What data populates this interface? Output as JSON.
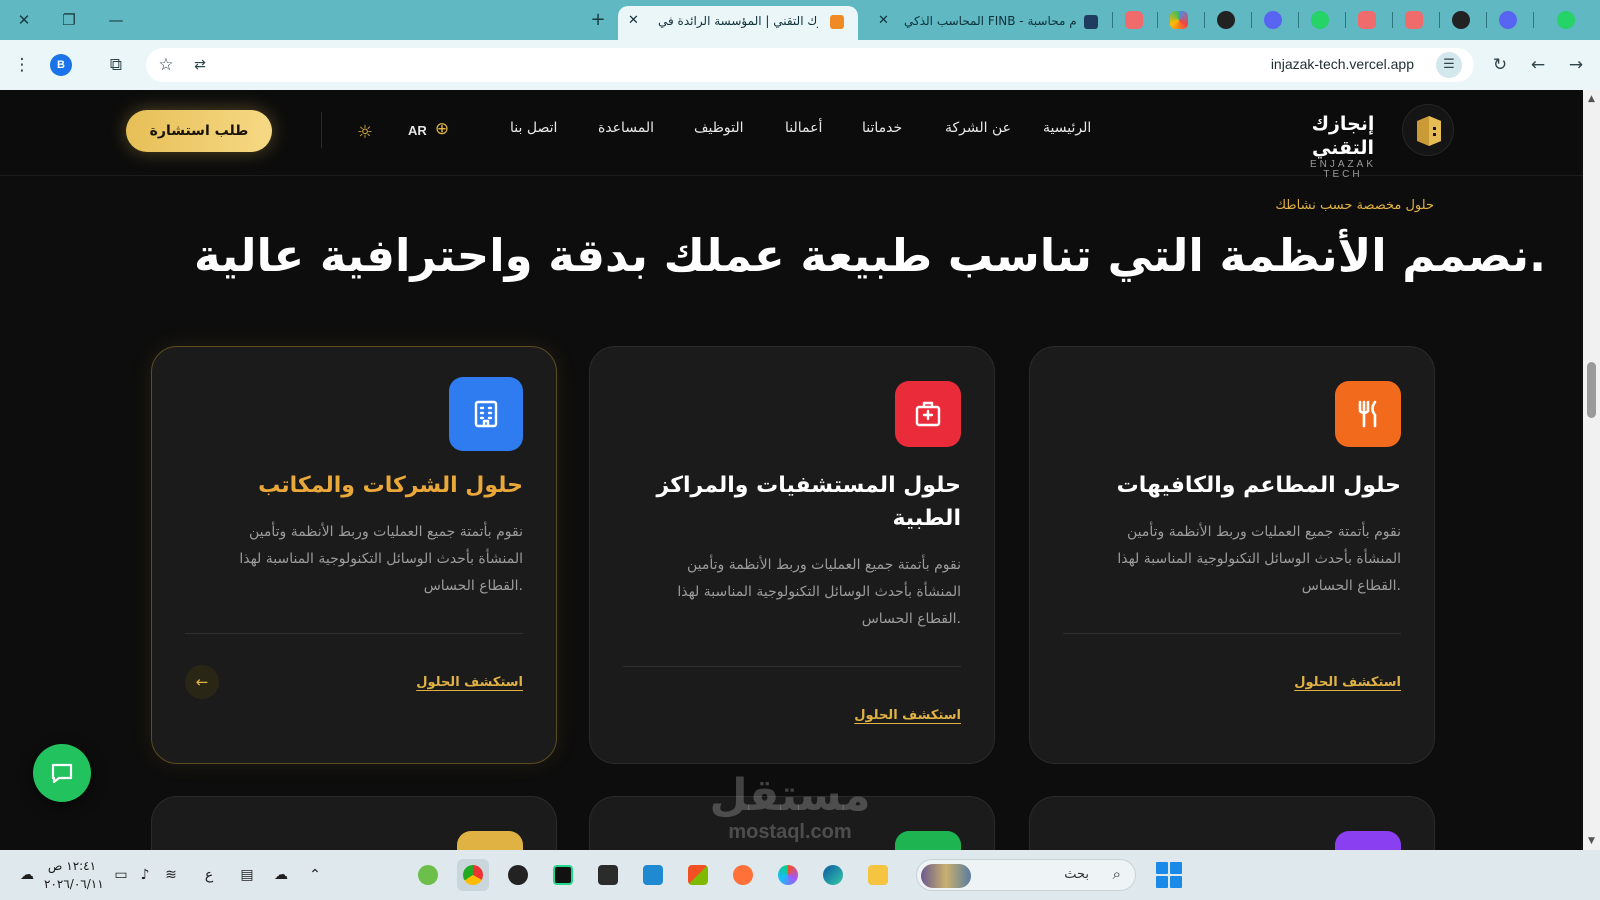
{
  "browser": {
    "active_tab_title": "إنجازك التقني | المؤسسة الرائدة في",
    "second_tab_title": "المحاسب الذكي FINB - نظام محاسبة",
    "new_tab_symbol": "+",
    "url": "injazak-tech.vercel.app",
    "profile_initial": "B",
    "colors": {
      "tabbar": "#5fb8c2",
      "toolbar": "#eaf6f8"
    }
  },
  "site": {
    "brand_ar": "إنجازك التقني",
    "brand_en": "ENJAZAK TECH",
    "nav": [
      "الرئيسية",
      "عن الشركة",
      "خدماتنا",
      "أعمالنا",
      "التوظيف",
      "المساعدة",
      "اتصل بنا"
    ],
    "language": "AR",
    "cta_label": "طلب استشارة",
    "accent_color": "#e0b143"
  },
  "section": {
    "eyebrow": "حلول مخصصة حسب نشاطك",
    "headline": "نصمم الأنظمة التي تناسب طبيعة عملك بدقة واحترافية عالية."
  },
  "cards": [
    {
      "title": "حلول المطاعم والكافيهات",
      "desc": "نقوم بأتمتة جميع العمليات وربط الأنظمة وتأمين المنشأة بأحدث الوسائل التكنولوجية المناسبة لهذا القطاع الحساس.",
      "link": "استكشف الحلول",
      "icon": "fork-knife-icon",
      "icon_color": "#f26a1b"
    },
    {
      "title": "حلول المستشفيات والمراكز الطبية",
      "desc": "نقوم بأتمتة جميع العمليات وربط الأنظمة وتأمين المنشأة بأحدث الوسائل التكنولوجية المناسبة لهذا القطاع الحساس.",
      "link": "استكشف الحلول",
      "icon": "hospital-icon",
      "icon_color": "#ea2c3a"
    },
    {
      "title": "حلول الشركات والمكاتب",
      "desc": "نقوم بأتمتة جميع العمليات وربط الأنظمة وتأمين المنشأة بأحدث الوسائل التكنولوجية المناسبة لهذا القطاع الحساس.",
      "link": "استكشف الحلول",
      "icon": "office-building-icon",
      "icon_color": "#2f7cf0",
      "arrow": "←"
    }
  ],
  "watermark": {
    "ar": "مستقل",
    "en": "mostaql.com"
  },
  "taskbar": {
    "time": "١٢:٤١ ص",
    "date": "٢٠٢٦/٠٦/١١",
    "input_lang": "ع",
    "search_placeholder": "بحث"
  }
}
